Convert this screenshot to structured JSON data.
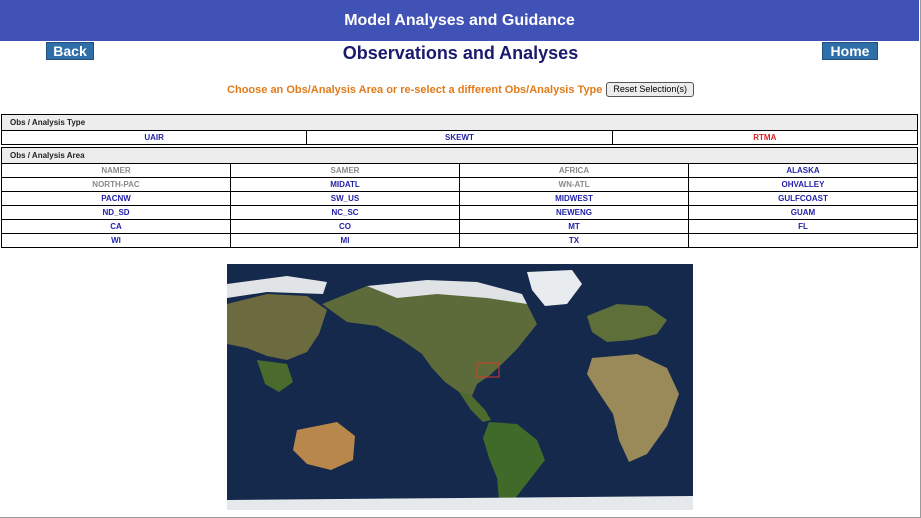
{
  "header": {
    "title": "Model Analyses and Guidance",
    "subtitle": "Observations and Analyses"
  },
  "nav": {
    "back_label": "Back",
    "home_label": "Home"
  },
  "instructions": {
    "text": "Choose an Obs/Analysis Area or re-select a different Obs/Analysis Type",
    "reset_label": "Reset Selection(s)"
  },
  "type_section": {
    "header": "Obs / Analysis Type",
    "items": [
      {
        "label": "UAIR",
        "state": "link"
      },
      {
        "label": "SKEWT",
        "state": "link"
      },
      {
        "label": "RTMA",
        "state": "selected"
      }
    ]
  },
  "area_section": {
    "header": "Obs / Analysis Area",
    "rows": [
      [
        {
          "label": "NAMER",
          "state": "disabled"
        },
        {
          "label": "SAMER",
          "state": "disabled"
        },
        {
          "label": "AFRICA",
          "state": "disabled"
        },
        {
          "label": "ALASKA",
          "state": "link"
        }
      ],
      [
        {
          "label": "NORTH-PAC",
          "state": "disabled"
        },
        {
          "label": "MIDATL",
          "state": "link"
        },
        {
          "label": "WN-ATL",
          "state": "disabled"
        },
        {
          "label": "OHVALLEY",
          "state": "link"
        }
      ],
      [
        {
          "label": "PACNW",
          "state": "link"
        },
        {
          "label": "SW_US",
          "state": "link"
        },
        {
          "label": "MIDWEST",
          "state": "link"
        },
        {
          "label": "GULFCOAST",
          "state": "link"
        }
      ],
      [
        {
          "label": "ND_SD",
          "state": "link"
        },
        {
          "label": "NC_SC",
          "state": "link"
        },
        {
          "label": "NEWENG",
          "state": "link"
        },
        {
          "label": "GUAM",
          "state": "link"
        }
      ],
      [
        {
          "label": "CA",
          "state": "link"
        },
        {
          "label": "CO",
          "state": "link"
        },
        {
          "label": "MT",
          "state": "link"
        },
        {
          "label": "FL",
          "state": "link"
        }
      ],
      [
        {
          "label": "WI",
          "state": "link"
        },
        {
          "label": "MI",
          "state": "link"
        },
        {
          "label": "TX",
          "state": "link"
        },
        {
          "label": "",
          "state": "empty"
        }
      ]
    ]
  },
  "colors": {
    "banner": "#4052b5",
    "link": "#1f1fa8",
    "selected": "#e02020",
    "disabled": "#8a8a8a",
    "instruction": "#e07b1a"
  },
  "map": {
    "icon": "world-map-image"
  }
}
